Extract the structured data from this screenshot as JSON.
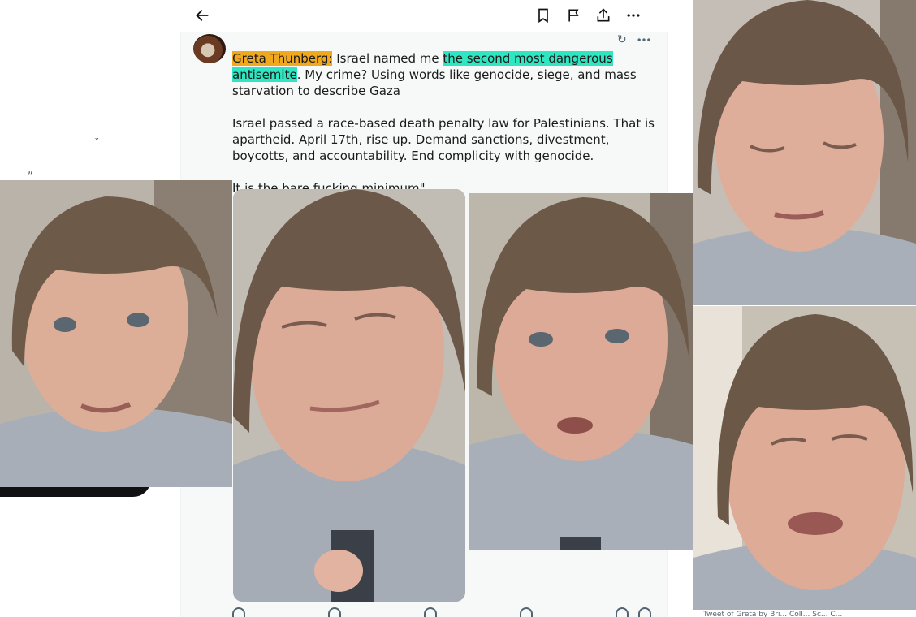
{
  "post": {
    "author_highlight": "Greta Thunberg:",
    "text_1a": " Israel named me ",
    "text_highlight": "the second most dangerous antisemite",
    "text_1b": ". My crime? Using words like genocide, siege, and mass starvation to describe Gaza",
    "paragraph_2": "Israel passed a race-based death penalty law for Palestinians. That is apartheid. April 17th, rise up. Demand sanctions, divestment, boycotts, and accountability. End complicity with genocide.",
    "paragraph_3": "It is the bare fucking minimum\""
  },
  "icons": {
    "back": "arrow-left-icon",
    "bookmark": "bookmark-icon",
    "report": "flag-icon",
    "share": "share-icon",
    "more": "more-horizontal-icon",
    "translate": "grok-icon",
    "post_more": "more-horizontal-icon",
    "reply": "reply-icon",
    "repost": "repost-icon",
    "like": "heart-icon",
    "views": "views-icon",
    "bookmark_small": "bookmark-icon",
    "share_small": "share-icon"
  },
  "colors": {
    "author_highlight": "#f0a81e",
    "phrase_highlight": "#2ee6c2",
    "text": "#1a1a1a",
    "icon": "#0f1419"
  },
  "stray_marks": [
    "ˇ",
    "ˮ"
  ],
  "caption_tail": "Tweet  of  Greta  by  Bri...  Coll...  Sc...  C..."
}
